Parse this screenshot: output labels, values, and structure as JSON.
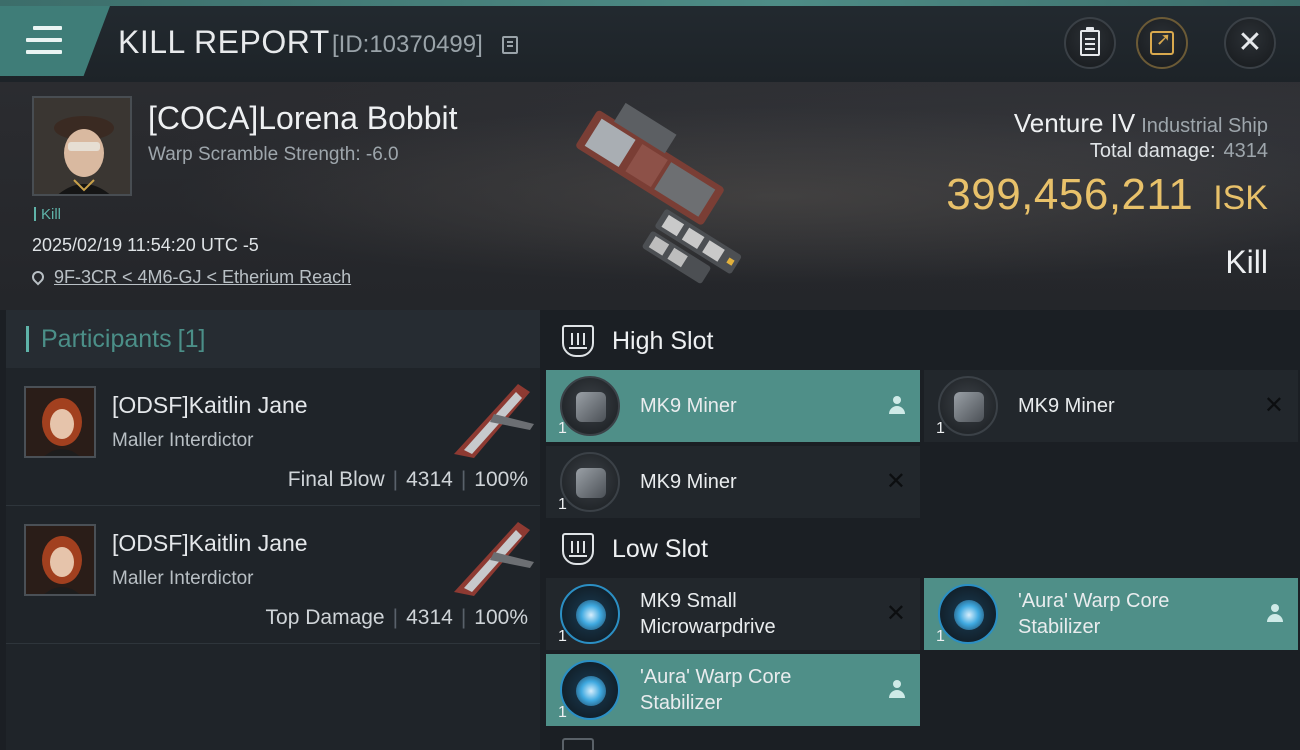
{
  "header": {
    "title": "KILL REPORT",
    "report_id": "[ID:10370499]"
  },
  "victim": {
    "name": "[COCA]Lorena Bobbit",
    "warp_scramble": "Warp Scramble Strength: -6.0",
    "kill_tag": "Kill",
    "timestamp": "2025/02/19 11:54:20 UTC -5",
    "location": "9F-3CR < 4M6-GJ < Etherium Reach",
    "ship_name": "Venture IV",
    "ship_class": "Industrial Ship",
    "total_damage_label": "Total damage:",
    "total_damage_value": "4314",
    "isk_value": "399,456,211",
    "isk_unit": "ISK",
    "result": "Kill"
  },
  "participants": {
    "label": "Participants",
    "count": "[1]",
    "rows": [
      {
        "name": "[ODSF]Kaitlin Jane",
        "ship": "Maller Interdictor",
        "role": "Final Blow",
        "damage": "4314",
        "percent": "100%"
      },
      {
        "name": "[ODSF]Kaitlin Jane",
        "ship": "Maller Interdictor",
        "role": "Top Damage",
        "damage": "4314",
        "percent": "100%"
      }
    ]
  },
  "fitting": {
    "high_slot": {
      "title": "High Slot",
      "modules": [
        {
          "name": "MK9 Miner",
          "qty": "1",
          "status": "dropped"
        },
        {
          "name": "MK9 Miner",
          "qty": "1",
          "status": "destroyed"
        },
        {
          "name": "MK9 Miner",
          "qty": "1",
          "status": "destroyed"
        }
      ]
    },
    "low_slot": {
      "title": "Low Slot",
      "modules": [
        {
          "name_line1": "MK9 Small",
          "name_line2": "Microwarpdrive",
          "qty": "1",
          "status": "destroyed"
        },
        {
          "name_line1": "'Aura' Warp Core",
          "name_line2": "Stabilizer",
          "qty": "1",
          "status": "dropped"
        },
        {
          "name_line1": "'Aura' Warp Core",
          "name_line2": "Stabilizer",
          "qty": "1",
          "status": "dropped"
        }
      ]
    }
  },
  "icons": {
    "menu": "hamburger-menu-icon",
    "copy": "copy-icon",
    "clipboard": "clipboard-icon",
    "share": "share-icon",
    "close": "close-icon",
    "location": "location-pin-icon",
    "slot": "slot-shield-icon",
    "dropped": "person-icon",
    "destroyed": "x-mark-icon"
  },
  "colors": {
    "accent_teal": "#4f8f88",
    "isk_gold": "#e8c16a",
    "participants_label": "#4b8f88",
    "background": "#1b1f24"
  }
}
